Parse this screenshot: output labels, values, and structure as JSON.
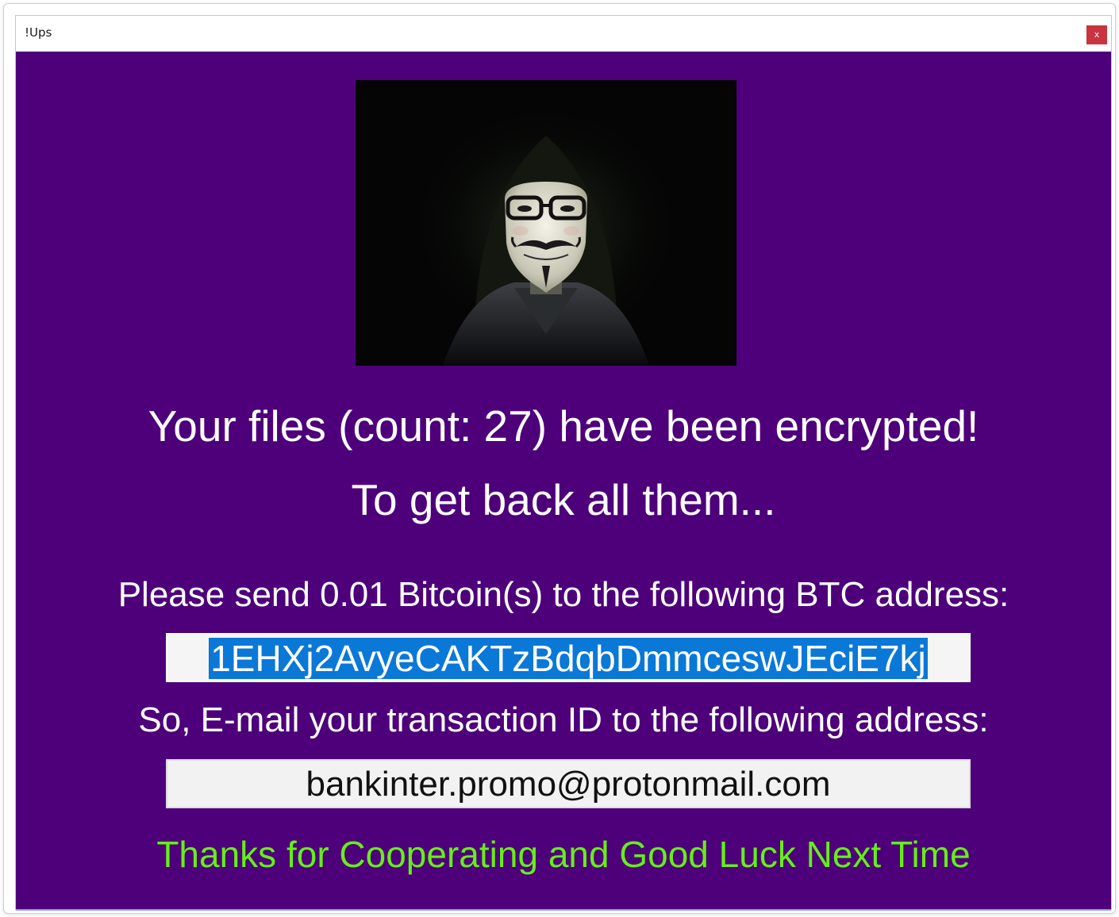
{
  "window": {
    "title": "!Ups",
    "close_label": "x"
  },
  "ransom": {
    "headline": "Your files (count: 27) have been encrypted!",
    "subheadline": "To get back all them...",
    "payment_instruction": "Please send 0.01 Bitcoin(s) to the following BTC address:",
    "btc_address": "1EHXj2AvyeCAKTzBdqbDmmceswJEciE7kj",
    "email_instruction": "So, E-mail your transaction ID to the following address:",
    "email_address": "bankinter.promo@protonmail.com",
    "closing": "Thanks for Cooperating and Good Luck Next Time"
  },
  "colors": {
    "background": "#4d0079",
    "text": "#ffffff",
    "closing_text": "#66ee1b",
    "selection": "#0a78d7",
    "close_button": "#c9343f"
  },
  "image": {
    "icon": "masked-hacker-photo"
  }
}
